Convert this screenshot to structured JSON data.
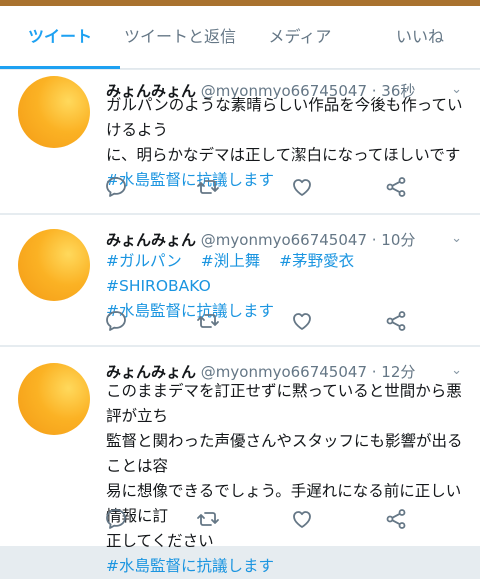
{
  "tabs": [
    {
      "label": "ツイート",
      "active": true
    },
    {
      "label": "ツイートと返信",
      "active": false
    },
    {
      "label": "メディア",
      "active": false
    },
    {
      "label": "いいね",
      "active": false
    }
  ],
  "tweets": [
    {
      "name": "みょんみょん",
      "handle": "@myonmyo66745047",
      "time": "36秒",
      "text_lines": [
        "ガルパンのような素晴らしい作品を今後も作っていけるよう",
        "に、明らかなデマは正して潔白になってほしいです"
      ],
      "hashtags": [
        "#水島監督に抗議します"
      ]
    },
    {
      "name": "みょんみょん",
      "handle": "@myonmyo66745047",
      "time": "10分",
      "text_lines": [],
      "tag_row": [
        "#ガルパン",
        "#渕上舞",
        "#茅野愛衣",
        "#SHIROBAKO"
      ],
      "hashtags": [
        "#水島監督に抗議します"
      ]
    },
    {
      "name": "みょんみょん",
      "handle": "@myonmyo66745047",
      "time": "12分",
      "text_lines": [
        "このままデマを訂正せずに黙っていると世間から悪評が立ち",
        "監督と関わった声優さんやスタッフにも影響が出ることは容",
        "易に想像できるでしょう。手遅れになる前に正しい情報に訂",
        "正してください"
      ],
      "hashtags": [
        "#水島監督に抗議します"
      ]
    }
  ],
  "separator": " · ",
  "icons": {
    "reply": "reply-icon",
    "retweet": "retweet-icon",
    "like": "heart-icon",
    "share": "share-icon",
    "caret": "chevron-down-icon"
  },
  "colors": {
    "accent": "#1da1f2",
    "hashtag": "#1b95e0",
    "icon": "#657786",
    "avatar": "#f7a51f"
  }
}
